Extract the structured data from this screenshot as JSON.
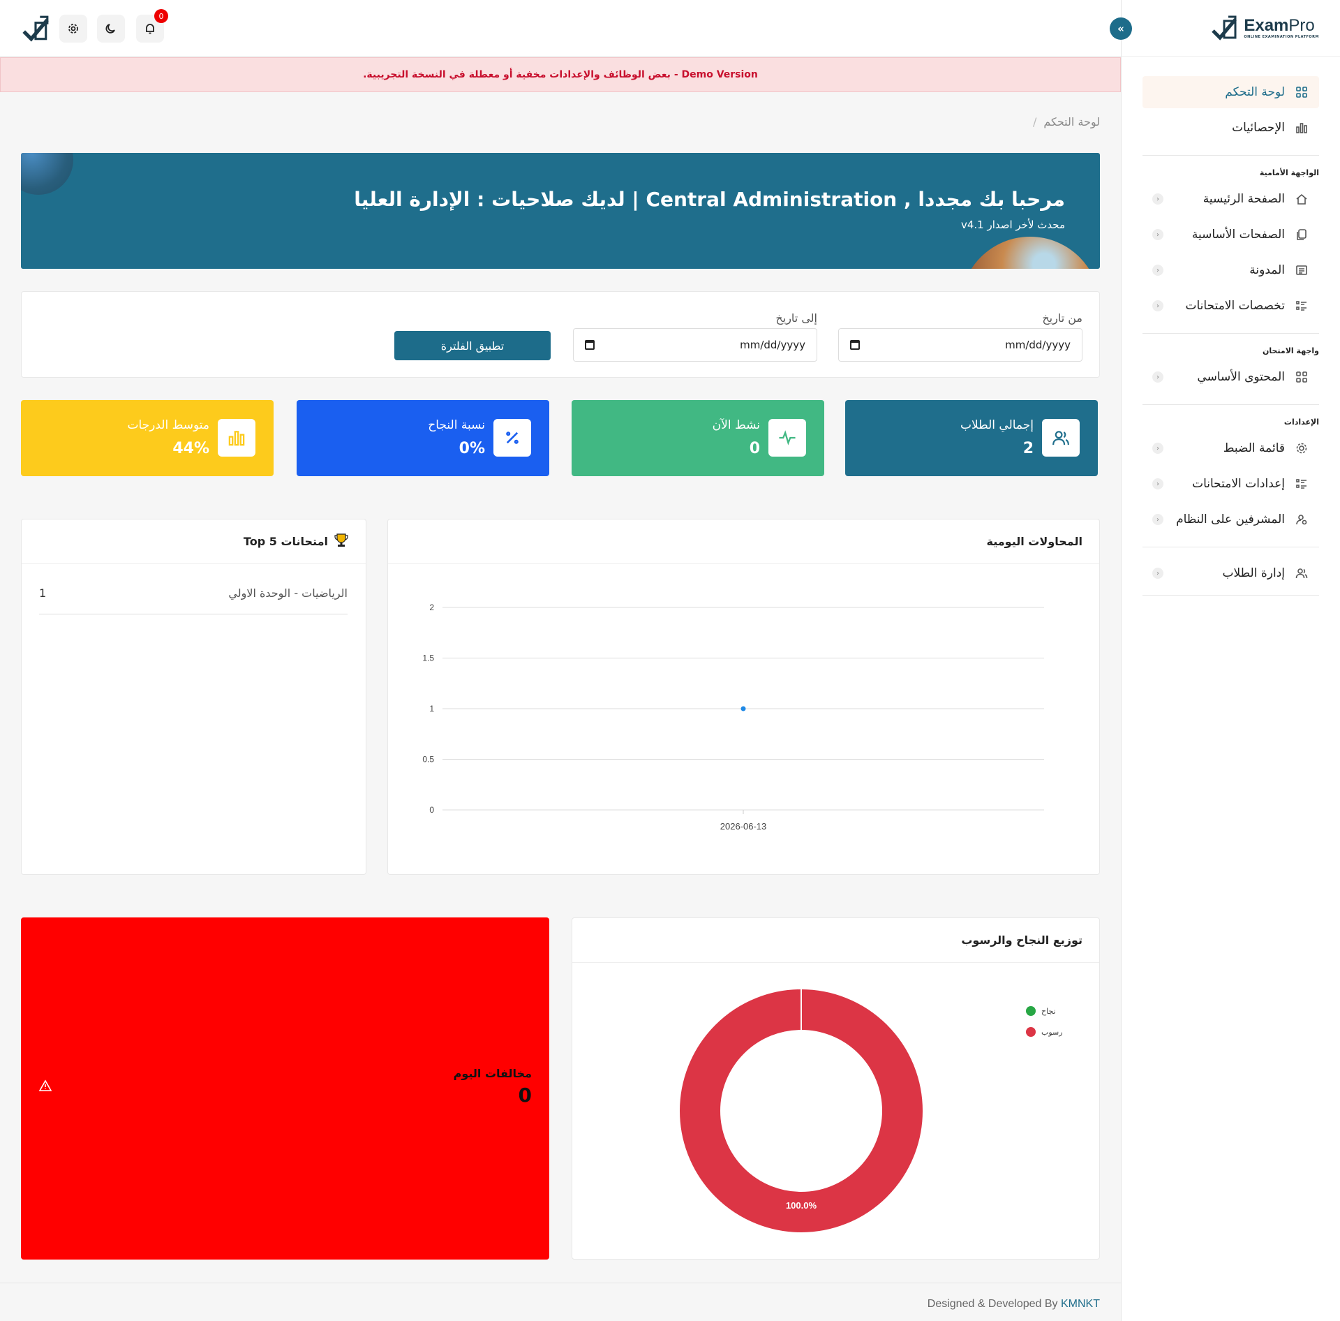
{
  "app": {
    "name_bold": "Exam",
    "name_light": "Pro",
    "tagline": "ONLINE EXAMINATION PLATFORM"
  },
  "topbar": {
    "notification_count": "0"
  },
  "demo_banner": "Demo Version - بعض الوظائف والإعدادات مخفية أو معطلة في النسخة التجريبية.",
  "breadcrumb": {
    "current": "لوحة التحكم",
    "separator": "/"
  },
  "sidebar": {
    "items_main": [
      {
        "label": "لوحة التحكم",
        "icon": "grid-icon",
        "active": true
      },
      {
        "label": "الإحصائيات",
        "icon": "bar-chart-icon"
      }
    ],
    "section_front": "الواجهة الأمامية",
    "items_front": [
      {
        "label": "الصفحة الرئيسية",
        "icon": "home-icon"
      },
      {
        "label": "الصفحات الأساسية",
        "icon": "pages-icon"
      },
      {
        "label": "المدونة",
        "icon": "blog-icon"
      },
      {
        "label": "تخصصات الامتحانات",
        "icon": "list-icon"
      }
    ],
    "section_exam": "واجهة الامتحان",
    "items_exam": [
      {
        "label": "المحتوى الأساسي",
        "icon": "grid-icon"
      }
    ],
    "section_settings": "الإعدادات",
    "items_settings": [
      {
        "label": "قائمة الضبط",
        "icon": "gear-icon"
      },
      {
        "label": "إعدادات الامتحانات",
        "icon": "list-icon"
      },
      {
        "label": "المشرفين على النظام",
        "icon": "user-gear-icon"
      }
    ],
    "items_students": [
      {
        "label": "إدارة الطلاب",
        "icon": "users-icon"
      }
    ]
  },
  "hero": {
    "title": "مرحبا بك مجددا , Central Administration | لديك صلاحيات : الإدارة العليا",
    "subtitle": "محدث لأخر اصدار v4.1"
  },
  "filter": {
    "from_label": "من تاريخ",
    "to_label": "إلى تاريخ",
    "from_value": "mm/dd/yyyy",
    "to_value": "mm/dd/yyyy",
    "apply_label": "تطبيق الفلترة"
  },
  "stats": [
    {
      "label": "إجمالي الطلاب",
      "value": "2",
      "color": "#1f6e8c",
      "icon": "users-icon"
    },
    {
      "label": "نشط الآن",
      "value": "0",
      "color": "#41b883",
      "icon": "activity-icon"
    },
    {
      "label": "نسبة النجاح",
      "value": "0%",
      "color": "#1a5ff0",
      "icon": "percent-icon"
    },
    {
      "label": "متوسط الدرجات",
      "value": "44%",
      "color": "#fdcb1c",
      "icon": "bar-chart-icon"
    }
  ],
  "daily_attempts": {
    "title": "المحاولات اليومية"
  },
  "top5": {
    "title": "Top 5 امتحانات",
    "rows": [
      {
        "name": "الرياضيات - الوحدة الاولي",
        "count": "1"
      }
    ]
  },
  "pass_fail": {
    "title": "توزيع النجاح والرسوب"
  },
  "violations": {
    "label": "مخالفات اليوم",
    "value": "0"
  },
  "footer": {
    "text": "Designed & Developed By",
    "link": "KMNKT"
  },
  "chart_data": [
    {
      "type": "line",
      "title": "المحاولات اليومية",
      "x": [
        "2026-06-13"
      ],
      "series": [
        {
          "values": [
            1
          ]
        }
      ],
      "yticks": [
        "2",
        "1.5",
        "1",
        "0.5",
        "0"
      ],
      "ylim": [
        0,
        2
      ],
      "grid": true,
      "point_color": "#1e88e5"
    },
    {
      "type": "pie",
      "title": "توزيع النجاح والرسوب",
      "categories": [
        "نجاح",
        "رسوب"
      ],
      "values": [
        0,
        100
      ],
      "colors": [
        "#28a745",
        "#dc3545"
      ],
      "labels": [
        "",
        "100.0%"
      ],
      "legend": "top-right"
    }
  ]
}
